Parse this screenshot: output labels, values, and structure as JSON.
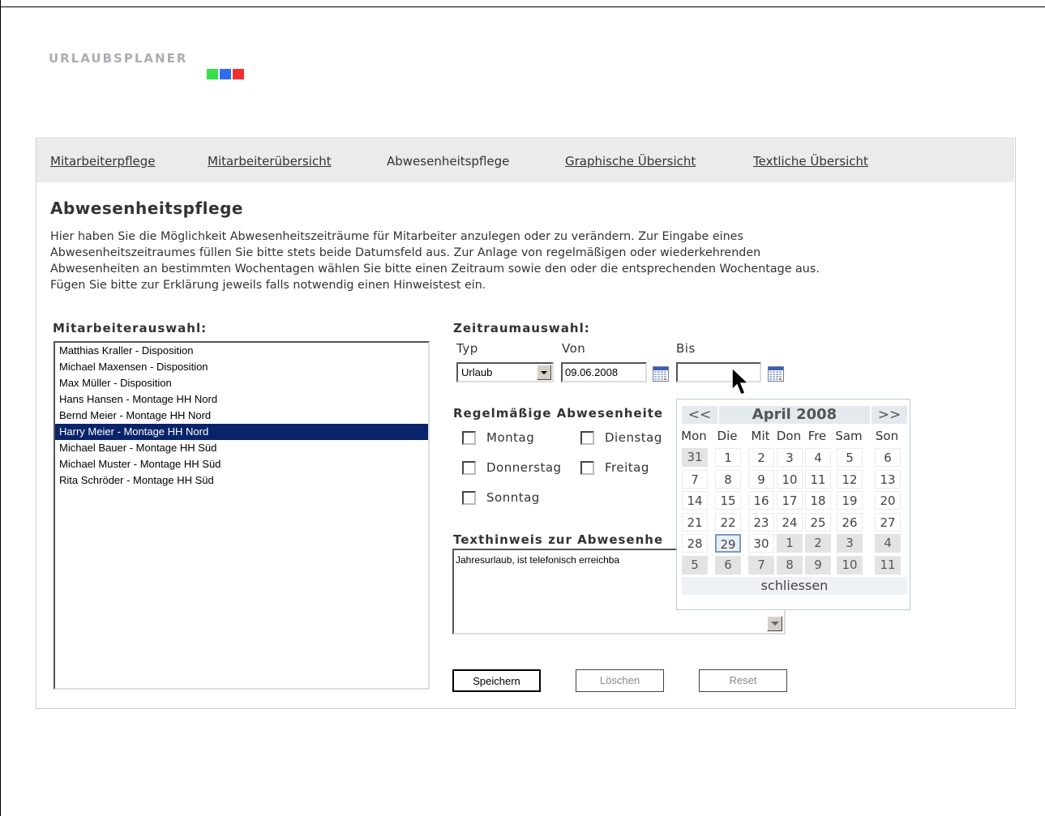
{
  "logo": {
    "text": "URLAUBSPLANER",
    "square_colors": [
      "#35e04a",
      "#2f6cf2",
      "#f2302f"
    ]
  },
  "nav": {
    "items": [
      {
        "label": "Mitarbeiterpflege",
        "active": false
      },
      {
        "label": "Mitarbeiterübersicht",
        "active": false
      },
      {
        "label": "Abwesenheitspflege",
        "active": true
      },
      {
        "label": "Graphische Übersicht",
        "active": false
      },
      {
        "label": "Textliche Übersicht",
        "active": false
      }
    ]
  },
  "page": {
    "title": "Abwesenheitspflege",
    "intro_lines": [
      "Hier haben Sie die Möglichkeit Abwesenheitszeiträume für Mitarbeiter anzulegen oder zu verändern. Zur Eingabe eines",
      "Abwesenheitszeitraumes füllen Sie bitte stets beide Datumsfeld aus. Zur Anlage von regelmäßigen oder wiederkehrenden",
      "Abwesenheiten an bestimmten Wochentagen wählen Sie bitte einen Zeitraum sowie den oder die entsprechenden Wochentage aus.",
      "Fügen Sie bitte zur Erklärung jeweils falls notwendig einen Hinweistest ein."
    ]
  },
  "employees": {
    "label": "Mitarbeiterauswahl:",
    "items": [
      "Matthias Kraller - Disposition",
      "Michael Maxensen - Disposition",
      "Max Müller - Disposition",
      "Hans Hansen - Montage HH Nord",
      "Bernd Meier - Montage HH Nord",
      "Harry Meier - Montage HH Nord",
      "Michael Bauer - Montage HH Süd",
      "Michael Muster - Montage HH Süd",
      "Rita Schröder - Montage HH Süd"
    ],
    "selected_index": 5
  },
  "period": {
    "label": "Zeitraumauswahl:",
    "type_label": "Typ",
    "from_label": "Von",
    "to_label": "Bis",
    "type_value": "Urlaub",
    "from_value": "09.06.2008",
    "to_value": ""
  },
  "recurring": {
    "label": "Regelmäßige Abwesenheite",
    "days": [
      "Montag",
      "Dienstag",
      "Donnerstag",
      "Freitag",
      "Sonntag"
    ]
  },
  "note": {
    "label": "Texthinweis zur Abwesenhe",
    "value": "Jahresurlaub, ist telefonisch erreichba"
  },
  "buttons": {
    "save": "Speichern",
    "delete": "Löschen",
    "reset": "Reset"
  },
  "calendar": {
    "prev": "<<",
    "next": ">>",
    "title": "April 2008",
    "weekdays": [
      "Mon",
      "Die",
      "Mit",
      "Don",
      "Fre",
      "Sam",
      "Son"
    ],
    "weeks": [
      [
        31,
        1,
        2,
        3,
        4,
        5,
        6
      ],
      [
        7,
        8,
        9,
        10,
        11,
        12,
        13
      ],
      [
        14,
        15,
        16,
        17,
        18,
        19,
        20
      ],
      [
        21,
        22,
        23,
        24,
        25,
        26,
        27
      ],
      [
        28,
        29,
        30,
        1,
        2,
        3,
        4
      ],
      [
        5,
        6,
        7,
        8,
        9,
        10,
        11
      ]
    ],
    "highlighted_day": 29,
    "close": "schliessen"
  }
}
